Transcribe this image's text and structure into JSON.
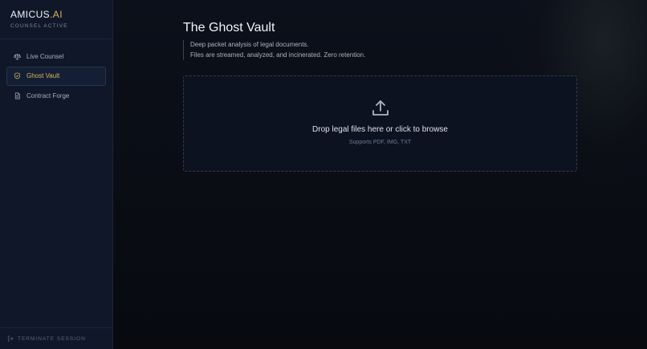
{
  "brand": {
    "name": "AMICUS",
    "suffix": ".AI",
    "status": "COUNSEL ACTIVE"
  },
  "sidebar": {
    "items": [
      {
        "label": "Live Counsel",
        "icon": "scales-icon",
        "active": false
      },
      {
        "label": "Ghost Vault",
        "icon": "shield-icon",
        "active": true
      },
      {
        "label": "Contract Forge",
        "icon": "document-icon",
        "active": false
      }
    ],
    "footer": {
      "label": "TERMINATE SESSION",
      "icon": "logout-icon"
    }
  },
  "main": {
    "title": "The Ghost Vault",
    "description": [
      "Deep packet analysis of legal documents.",
      "Files are streamed, analyzed, and incinerated. Zero retention."
    ],
    "dropzone": {
      "title": "Drop legal files here or click to browse",
      "subtitle": "Supports PDF, IMG, TXT",
      "icon": "upload-icon"
    }
  },
  "colors": {
    "accent": "#d4b45a",
    "sidebar_bg": "#0f1729",
    "main_bg": "#0a0d14"
  }
}
